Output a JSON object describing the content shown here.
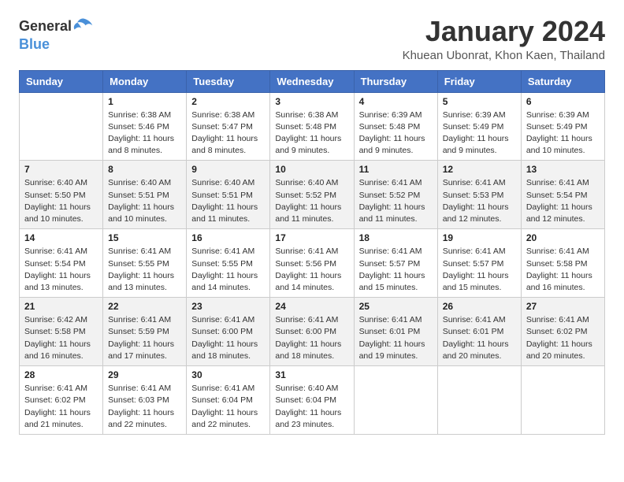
{
  "logo": {
    "general": "General",
    "blue": "Blue"
  },
  "title": "January 2024",
  "subtitle": "Khuean Ubonrat, Khon Kaen, Thailand",
  "days_of_week": [
    "Sunday",
    "Monday",
    "Tuesday",
    "Wednesday",
    "Thursday",
    "Friday",
    "Saturday"
  ],
  "weeks": [
    [
      {
        "day": "",
        "info": ""
      },
      {
        "day": "1",
        "info": "Sunrise: 6:38 AM\nSunset: 5:46 PM\nDaylight: 11 hours\nand 8 minutes."
      },
      {
        "day": "2",
        "info": "Sunrise: 6:38 AM\nSunset: 5:47 PM\nDaylight: 11 hours\nand 8 minutes."
      },
      {
        "day": "3",
        "info": "Sunrise: 6:38 AM\nSunset: 5:48 PM\nDaylight: 11 hours\nand 9 minutes."
      },
      {
        "day": "4",
        "info": "Sunrise: 6:39 AM\nSunset: 5:48 PM\nDaylight: 11 hours\nand 9 minutes."
      },
      {
        "day": "5",
        "info": "Sunrise: 6:39 AM\nSunset: 5:49 PM\nDaylight: 11 hours\nand 9 minutes."
      },
      {
        "day": "6",
        "info": "Sunrise: 6:39 AM\nSunset: 5:49 PM\nDaylight: 11 hours\nand 10 minutes."
      }
    ],
    [
      {
        "day": "7",
        "info": "Sunrise: 6:40 AM\nSunset: 5:50 PM\nDaylight: 11 hours\nand 10 minutes."
      },
      {
        "day": "8",
        "info": "Sunrise: 6:40 AM\nSunset: 5:51 PM\nDaylight: 11 hours\nand 10 minutes."
      },
      {
        "day": "9",
        "info": "Sunrise: 6:40 AM\nSunset: 5:51 PM\nDaylight: 11 hours\nand 11 minutes."
      },
      {
        "day": "10",
        "info": "Sunrise: 6:40 AM\nSunset: 5:52 PM\nDaylight: 11 hours\nand 11 minutes."
      },
      {
        "day": "11",
        "info": "Sunrise: 6:41 AM\nSunset: 5:52 PM\nDaylight: 11 hours\nand 11 minutes."
      },
      {
        "day": "12",
        "info": "Sunrise: 6:41 AM\nSunset: 5:53 PM\nDaylight: 11 hours\nand 12 minutes."
      },
      {
        "day": "13",
        "info": "Sunrise: 6:41 AM\nSunset: 5:54 PM\nDaylight: 11 hours\nand 12 minutes."
      }
    ],
    [
      {
        "day": "14",
        "info": "Sunrise: 6:41 AM\nSunset: 5:54 PM\nDaylight: 11 hours\nand 13 minutes."
      },
      {
        "day": "15",
        "info": "Sunrise: 6:41 AM\nSunset: 5:55 PM\nDaylight: 11 hours\nand 13 minutes."
      },
      {
        "day": "16",
        "info": "Sunrise: 6:41 AM\nSunset: 5:55 PM\nDaylight: 11 hours\nand 14 minutes."
      },
      {
        "day": "17",
        "info": "Sunrise: 6:41 AM\nSunset: 5:56 PM\nDaylight: 11 hours\nand 14 minutes."
      },
      {
        "day": "18",
        "info": "Sunrise: 6:41 AM\nSunset: 5:57 PM\nDaylight: 11 hours\nand 15 minutes."
      },
      {
        "day": "19",
        "info": "Sunrise: 6:41 AM\nSunset: 5:57 PM\nDaylight: 11 hours\nand 15 minutes."
      },
      {
        "day": "20",
        "info": "Sunrise: 6:41 AM\nSunset: 5:58 PM\nDaylight: 11 hours\nand 16 minutes."
      }
    ],
    [
      {
        "day": "21",
        "info": "Sunrise: 6:42 AM\nSunset: 5:58 PM\nDaylight: 11 hours\nand 16 minutes."
      },
      {
        "day": "22",
        "info": "Sunrise: 6:41 AM\nSunset: 5:59 PM\nDaylight: 11 hours\nand 17 minutes."
      },
      {
        "day": "23",
        "info": "Sunrise: 6:41 AM\nSunset: 6:00 PM\nDaylight: 11 hours\nand 18 minutes."
      },
      {
        "day": "24",
        "info": "Sunrise: 6:41 AM\nSunset: 6:00 PM\nDaylight: 11 hours\nand 18 minutes."
      },
      {
        "day": "25",
        "info": "Sunrise: 6:41 AM\nSunset: 6:01 PM\nDaylight: 11 hours\nand 19 minutes."
      },
      {
        "day": "26",
        "info": "Sunrise: 6:41 AM\nSunset: 6:01 PM\nDaylight: 11 hours\nand 20 minutes."
      },
      {
        "day": "27",
        "info": "Sunrise: 6:41 AM\nSunset: 6:02 PM\nDaylight: 11 hours\nand 20 minutes."
      }
    ],
    [
      {
        "day": "28",
        "info": "Sunrise: 6:41 AM\nSunset: 6:02 PM\nDaylight: 11 hours\nand 21 minutes."
      },
      {
        "day": "29",
        "info": "Sunrise: 6:41 AM\nSunset: 6:03 PM\nDaylight: 11 hours\nand 22 minutes."
      },
      {
        "day": "30",
        "info": "Sunrise: 6:41 AM\nSunset: 6:04 PM\nDaylight: 11 hours\nand 22 minutes."
      },
      {
        "day": "31",
        "info": "Sunrise: 6:40 AM\nSunset: 6:04 PM\nDaylight: 11 hours\nand 23 minutes."
      },
      {
        "day": "",
        "info": ""
      },
      {
        "day": "",
        "info": ""
      },
      {
        "day": "",
        "info": ""
      }
    ]
  ]
}
